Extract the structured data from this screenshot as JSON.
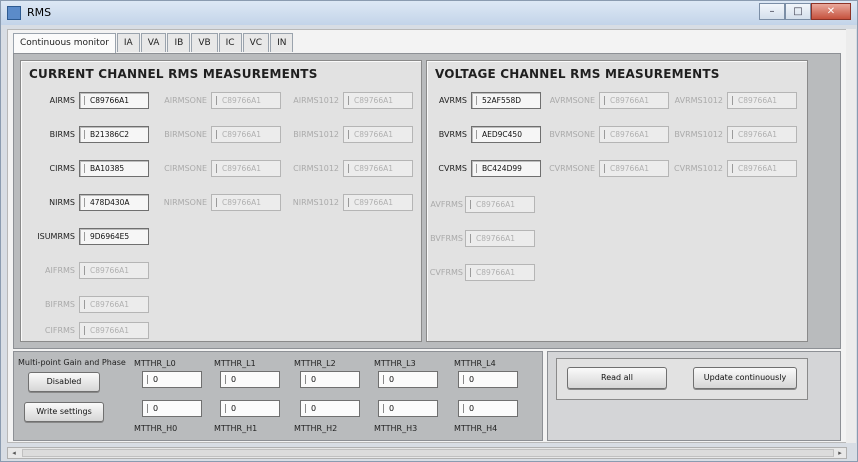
{
  "window": {
    "title": "RMS"
  },
  "tabs": [
    "Continuous monitor",
    "IA",
    "VA",
    "IB",
    "VB",
    "IC",
    "VC",
    "IN"
  ],
  "current_panel": {
    "title": "CURRENT CHANNEL RMS MEASUREMENTS",
    "rows": [
      {
        "label": "AIRMS",
        "value": "C89766A1",
        "rmsone_label": "AIRMSONE",
        "rmsone_value": "C89766A1",
        "rms1012_label": "AIRMS1012",
        "rms1012_value": "C89766A1"
      },
      {
        "label": "BIRMS",
        "value": "B21386C2",
        "rmsone_label": "BIRMSONE",
        "rmsone_value": "C89766A1",
        "rms1012_label": "BIRMS1012",
        "rms1012_value": "C89766A1"
      },
      {
        "label": "CIRMS",
        "value": "BA10385",
        "rmsone_label": "CIRMSONE",
        "rmsone_value": "C89766A1",
        "rms1012_label": "CIRMS1012",
        "rms1012_value": "C89766A1"
      },
      {
        "label": "NIRMS",
        "value": "478D430A",
        "rmsone_label": "NIRMSONE",
        "rmsone_value": "C89766A1",
        "rms1012_label": "NIRMS1012",
        "rms1012_value": "C89766A1"
      }
    ],
    "isum_label": "ISUMRMS",
    "isum_value": "9D6964E5",
    "fund": [
      {
        "label": "AIFRMS",
        "value": "C89766A1"
      },
      {
        "label": "BIFRMS",
        "value": "C89766A1"
      },
      {
        "label": "CIFRMS",
        "value": "C89766A1"
      }
    ]
  },
  "voltage_panel": {
    "title": "VOLTAGE CHANNEL RMS MEASUREMENTS",
    "rows": [
      {
        "label": "AVRMS",
        "value": "52AF558D",
        "rmsone_label": "AVRMSONE",
        "rmsone_value": "C89766A1",
        "rms1012_label": "AVRMS1012",
        "rms1012_value": "C89766A1"
      },
      {
        "label": "BVRMS",
        "value": "AED9C450",
        "rmsone_label": "BVRMSONE",
        "rmsone_value": "C89766A1",
        "rms1012_label": "BVRMS1012",
        "rms1012_value": "C89766A1"
      },
      {
        "label": "CVRMS",
        "value": "BC424D99",
        "rmsone_label": "CVRMSONE",
        "rmsone_value": "C89766A1",
        "rms1012_label": "CVRMS1012",
        "rms1012_value": "C89766A1"
      }
    ],
    "fund": [
      {
        "label": "AVFRMS",
        "value": "C89766A1"
      },
      {
        "label": "BVFRMS",
        "value": "C89766A1"
      },
      {
        "label": "CVFRMS",
        "value": "C89766A1"
      }
    ]
  },
  "gain_phase": {
    "title": "Multi-point Gain and Phase",
    "disabled_label": "Disabled",
    "write_label": "Write settings",
    "thr_l": [
      {
        "label": "MTTHR_L0",
        "value": "0"
      },
      {
        "label": "MTTHR_L1",
        "value": "0"
      },
      {
        "label": "MTTHR_L2",
        "value": "0"
      },
      {
        "label": "MTTHR_L3",
        "value": "0"
      },
      {
        "label": "MTTHR_L4",
        "value": "0"
      }
    ],
    "thr_h": [
      {
        "label": "MTTHR_H0",
        "value": "0"
      },
      {
        "label": "MTTHR_H1",
        "value": "0"
      },
      {
        "label": "MTTHR_H2",
        "value": "0"
      },
      {
        "label": "MTTHR_H3",
        "value": "0"
      },
      {
        "label": "MTTHR_H4",
        "value": "0"
      }
    ]
  },
  "actions": {
    "read_all": "Read all",
    "update_continuously": "Update continuously"
  }
}
